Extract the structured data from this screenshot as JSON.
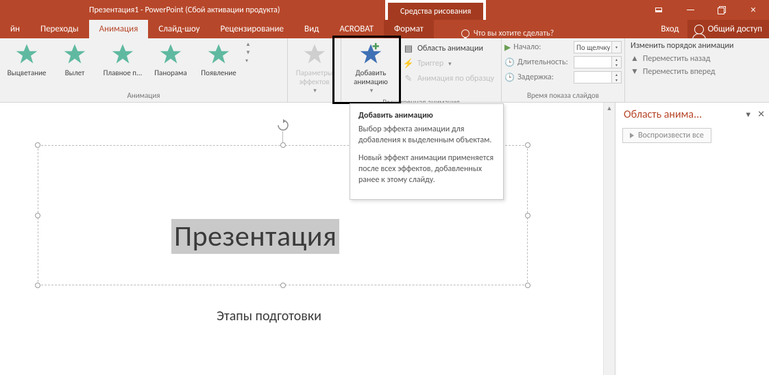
{
  "title": "Презентация1 - PowerPoint (Сбой активации продукта)",
  "context_tab": "Средства рисования",
  "tabs": {
    "design": "йн",
    "transitions": "Переходы",
    "animation": "Анимация",
    "slideshow": "Слайд-шоу",
    "review": "Рецензирование",
    "view": "Вид",
    "acrobat": "ACROBAT",
    "format": "Формат"
  },
  "tellme": "Что вы хотите сделать?",
  "signin": "Вход",
  "share": "Общий доступ",
  "gallery": {
    "fade": "Выцветание",
    "flyin": "Вылет",
    "float": "Плавное п...",
    "panorama": "Панорама",
    "appear": "Появление"
  },
  "group_labels": {
    "animation": "Анимация",
    "advanced": "Расширенная анимация",
    "timing": "Время показа слайдов"
  },
  "effect_options": "Параметры эффектов",
  "add_anim": "Добавить анимацию",
  "pane_btn": "Область анимации",
  "trigger": "Триггер",
  "painter": "Анимация по образцу",
  "timing": {
    "start_lbl": "Начало:",
    "start_val": "По щелчку",
    "dur_lbl": "Длительность:",
    "dur_val": "",
    "delay_lbl": "Задержка:",
    "delay_val": ""
  },
  "reorder": {
    "head": "Изменить порядок анимации",
    "back": "Переместить назад",
    "fwd": "Переместить вперед"
  },
  "tooltip": {
    "title": "Добавить анимацию",
    "p1": "Выбор эффекта анимации для добавления к выделенным объектам.",
    "p2": "Новый эффект анимации применяется после всех эффектов, добавленных ранее к этому слайду."
  },
  "slide": {
    "title": "Презентация",
    "subtitle": "Этапы подготовки"
  },
  "pane": {
    "title": "Область анима...",
    "play": "Воспроизвести все"
  }
}
